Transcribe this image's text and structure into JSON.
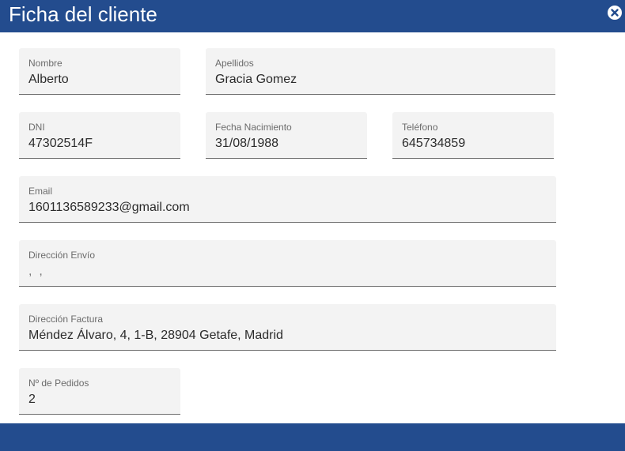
{
  "window": {
    "title": "Ficha del cliente",
    "close_icon": "close-circle-icon"
  },
  "fields": {
    "nombre": {
      "label": "Nombre",
      "value": "Alberto"
    },
    "apellidos": {
      "label": "Apellidos",
      "value": "Gracia Gomez"
    },
    "dni": {
      "label": "DNI",
      "value": "47302514F"
    },
    "fecha_nacimiento": {
      "label": "Fecha Nacimiento",
      "value": "31/08/1988"
    },
    "telefono": {
      "label": "Teléfono",
      "value": "645734859"
    },
    "email": {
      "label": "Email",
      "value": "1601136589233@gmail.com"
    },
    "direccion_envio": {
      "label": "Dirección Envío",
      "value": ",  ,"
    },
    "direccion_factura": {
      "label": "Dirección Factura",
      "value": "Méndez Álvaro, 4, 1-B, 28904 Getafe, Madrid"
    },
    "num_pedidos": {
      "label": "Nº de Pedidos",
      "value": "2"
    }
  },
  "colors": {
    "header_bg": "#234c8e",
    "field_bg": "#f3f3f3",
    "field_underline": "#6f6f6f"
  }
}
